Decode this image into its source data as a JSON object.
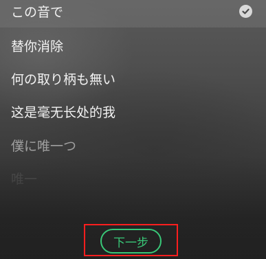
{
  "lyrics": {
    "selected_line": "この音で",
    "lines": [
      "替你消除",
      "何の取り柄も無い",
      "这是毫无长处的我",
      "僕に唯一つ",
      "唯一"
    ]
  },
  "actions": {
    "next_label": "下一步"
  },
  "colors": {
    "accent": "#39c878",
    "highlight_frame": "#ff1e1e"
  },
  "icons": {
    "selected_check": "check-circle-icon"
  }
}
